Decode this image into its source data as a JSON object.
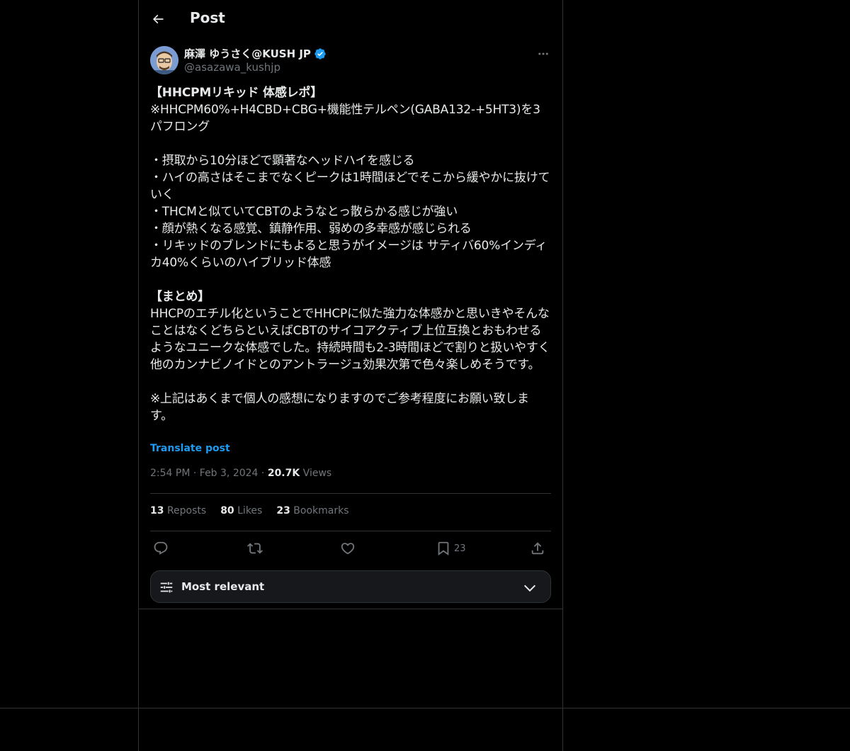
{
  "header": {
    "title": "Post"
  },
  "author": {
    "name": "麻澤 ゆうさく@KUSH JP",
    "handle": "@asazawa_kushjp",
    "verified": true,
    "verified_color": "#1d9bf0"
  },
  "post": {
    "title": "【HHCPMリキッド 体感レポ】",
    "intro": "※HHCPM60%+H4CBD+CBG+機能性テルペン(GABA132-+5HT3)を3パフロング",
    "bullets": "・摂取から10分ほどで顕著なヘッドハイを感じる\n・ハイの高さはそこまでなくピークは1時間ほどでそこから緩やかに抜けていく\n・THCMと似ていてCBTのようなとっ散らかる感じが強い\n・顔が熱くなる感覚、鎮静作用、弱めの多幸感が感じられる\n・リキッドのブレンドにもよると思うがイメージは サティバ60%インディカ40%くらいのハイブリッド体感",
    "summary_title": "【まとめ】",
    "summary": "HHCPのエチル化ということでHHCPに似た強力な体感かと思いきやそんなことはなくどちらといえばCBTのサイコアクティブ上位互換とおもわせるようなユニークな体感でした。持続時間も2-3時間ほどで割りと扱いやすく他のカンナビノイドとのアントラージュ効果次第で色々楽しめそうです。",
    "note": "※上記はあくまで個人の感想になりますのでご参考程度にお願い致します。",
    "translate_label": "Translate post"
  },
  "meta": {
    "time": "2:54 PM",
    "dot": "·",
    "date": "Feb 3, 2024",
    "views_count": "20.7K",
    "views_label": "Views"
  },
  "stats": {
    "reposts_count": "13",
    "reposts_label": "Reposts",
    "likes_count": "80",
    "likes_label": "Likes",
    "bookmarks_count": "23",
    "bookmarks_label": "Bookmarks"
  },
  "actions": {
    "bookmark_count": "23",
    "icons": [
      "reply-icon",
      "repost-icon",
      "like-icon",
      "bookmark-icon",
      "share-icon"
    ]
  },
  "sort": {
    "label": "Most relevant"
  },
  "colors": {
    "accent": "#1d9bf0",
    "text": "#e7e9ea",
    "muted": "#71767b",
    "border": "#2f3336"
  }
}
